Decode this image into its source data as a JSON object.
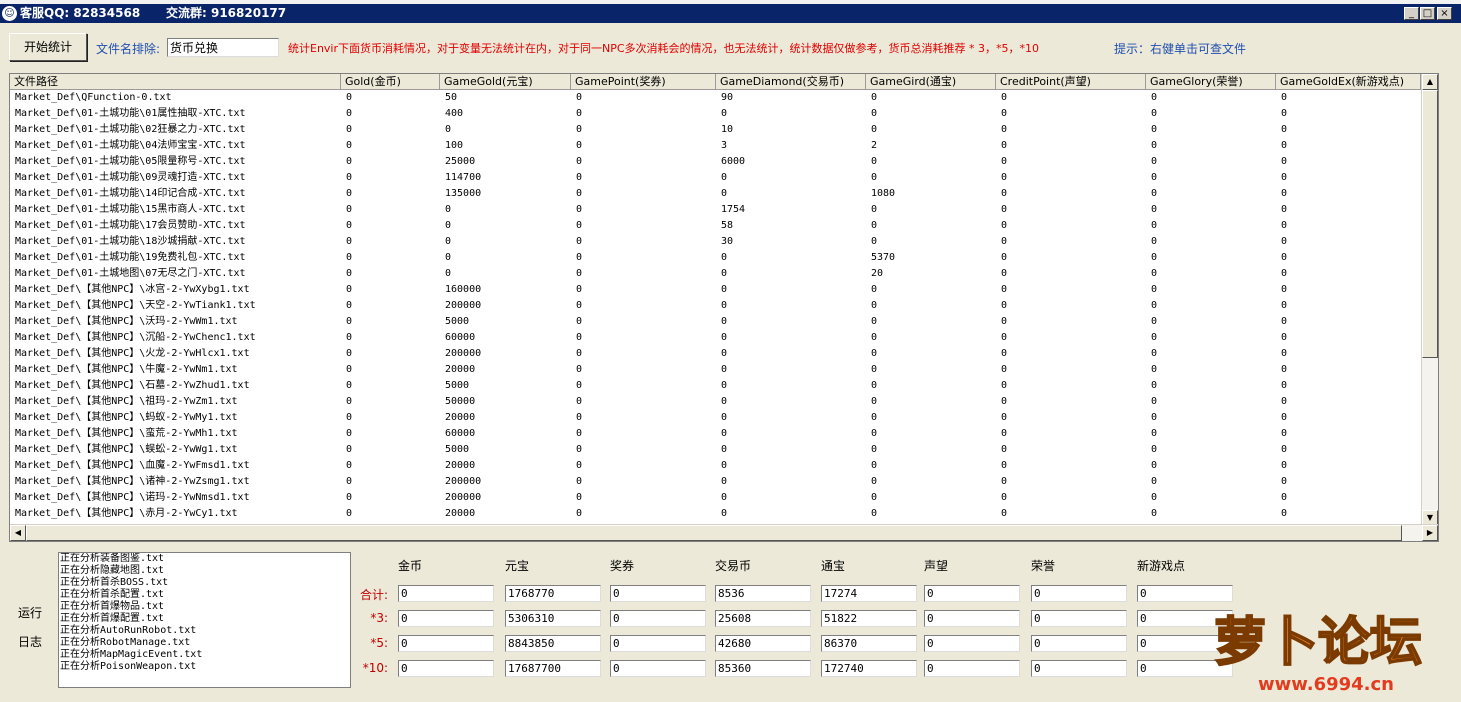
{
  "titlebar": {
    "title": "客服QQ: 82834568",
    "group": "交流群: 916820177"
  },
  "toolbar": {
    "start_button": "开始统计",
    "exclude_label": "文件名排除:",
    "exclude_value": "货币兑换",
    "note": "统计Envir下面货币消耗情况，对于变量无法统计在内，对于同一NPC多次消耗会的情况，也无法统计，统计数据仅做参考，货币总消耗推荐 * 3，*5，*10",
    "hint": "提示：右健单击可查文件"
  },
  "table": {
    "columns": [
      "文件路径",
      "Gold(金币)",
      "GameGold(元宝)",
      "GamePoint(奖券)",
      "GameDiamond(交易币)",
      "GameGird(通宝)",
      "CreditPoint(声望)",
      "GameGlory(荣誉)",
      "GameGoldEx(新游戏点)"
    ],
    "rows": [
      [
        "Market_Def\\QFunction-0.txt",
        "0",
        "50",
        "0",
        "90",
        "0",
        "0",
        "0",
        "0"
      ],
      [
        "Market_Def\\01-土城功能\\01属性抽取-XTC.txt",
        "0",
        "400",
        "0",
        "0",
        "0",
        "0",
        "0",
        "0"
      ],
      [
        "Market_Def\\01-土城功能\\02狂暴之力-XTC.txt",
        "0",
        "0",
        "0",
        "10",
        "0",
        "0",
        "0",
        "0"
      ],
      [
        "Market_Def\\01-土城功能\\04法师宝宝-XTC.txt",
        "0",
        "100",
        "0",
        "3",
        "2",
        "0",
        "0",
        "0"
      ],
      [
        "Market_Def\\01-土城功能\\05限量称号-XTC.txt",
        "0",
        "25000",
        "0",
        "6000",
        "0",
        "0",
        "0",
        "0"
      ],
      [
        "Market_Def\\01-土城功能\\09灵魂打造-XTC.txt",
        "0",
        "114700",
        "0",
        "0",
        "0",
        "0",
        "0",
        "0"
      ],
      [
        "Market_Def\\01-土城功能\\14印记合成-XTC.txt",
        "0",
        "135000",
        "0",
        "0",
        "1080",
        "0",
        "0",
        "0"
      ],
      [
        "Market_Def\\01-土城功能\\15黑市商人-XTC.txt",
        "0",
        "0",
        "0",
        "1754",
        "0",
        "0",
        "0",
        "0"
      ],
      [
        "Market_Def\\01-土城功能\\17会员赞助-XTC.txt",
        "0",
        "0",
        "0",
        "58",
        "0",
        "0",
        "0",
        "0"
      ],
      [
        "Market_Def\\01-土城功能\\18沙城捐献-XTC.txt",
        "0",
        "0",
        "0",
        "30",
        "0",
        "0",
        "0",
        "0"
      ],
      [
        "Market_Def\\01-土城功能\\19免费礼包-XTC.txt",
        "0",
        "0",
        "0",
        "0",
        "5370",
        "0",
        "0",
        "0"
      ],
      [
        "Market_Def\\01-土城地图\\07无尽之门-XTC.txt",
        "0",
        "0",
        "0",
        "0",
        "20",
        "0",
        "0",
        "0"
      ],
      [
        "Market_Def\\【其他NPC】\\冰宫-2-YwXybg1.txt",
        "0",
        "160000",
        "0",
        "0",
        "0",
        "0",
        "0",
        "0"
      ],
      [
        "Market_Def\\【其他NPC】\\天空-2-YwTiank1.txt",
        "0",
        "200000",
        "0",
        "0",
        "0",
        "0",
        "0",
        "0"
      ],
      [
        "Market_Def\\【其他NPC】\\沃玛-2-YwWm1.txt",
        "0",
        "5000",
        "0",
        "0",
        "0",
        "0",
        "0",
        "0"
      ],
      [
        "Market_Def\\【其他NPC】\\沉船-2-YwChenc1.txt",
        "0",
        "60000",
        "0",
        "0",
        "0",
        "0",
        "0",
        "0"
      ],
      [
        "Market_Def\\【其他NPC】\\火龙-2-YwHlcx1.txt",
        "0",
        "200000",
        "0",
        "0",
        "0",
        "0",
        "0",
        "0"
      ],
      [
        "Market_Def\\【其他NPC】\\牛魔-2-YwNm1.txt",
        "0",
        "20000",
        "0",
        "0",
        "0",
        "0",
        "0",
        "0"
      ],
      [
        "Market_Def\\【其他NPC】\\石墓-2-YwZhud1.txt",
        "0",
        "5000",
        "0",
        "0",
        "0",
        "0",
        "0",
        "0"
      ],
      [
        "Market_Def\\【其他NPC】\\祖玛-2-YwZm1.txt",
        "0",
        "50000",
        "0",
        "0",
        "0",
        "0",
        "0",
        "0"
      ],
      [
        "Market_Def\\【其他NPC】\\蚂蚁-2-YwMy1.txt",
        "0",
        "20000",
        "0",
        "0",
        "0",
        "0",
        "0",
        "0"
      ],
      [
        "Market_Def\\【其他NPC】\\蛮荒-2-YwMh1.txt",
        "0",
        "60000",
        "0",
        "0",
        "0",
        "0",
        "0",
        "0"
      ],
      [
        "Market_Def\\【其他NPC】\\蜈蚣-2-YwWg1.txt",
        "0",
        "5000",
        "0",
        "0",
        "0",
        "0",
        "0",
        "0"
      ],
      [
        "Market_Def\\【其他NPC】\\血魔-2-YwFmsd1.txt",
        "0",
        "20000",
        "0",
        "0",
        "0",
        "0",
        "0",
        "0"
      ],
      [
        "Market_Def\\【其他NPC】\\诸神-2-YwZsmg1.txt",
        "0",
        "200000",
        "0",
        "0",
        "0",
        "0",
        "0",
        "0"
      ],
      [
        "Market_Def\\【其他NPC】\\诺玛-2-YwNmsd1.txt",
        "0",
        "200000",
        "0",
        "0",
        "0",
        "0",
        "0",
        "0"
      ],
      [
        "Market_Def\\【其他NPC】\\赤月-2-YwCy1.txt",
        "0",
        "20000",
        "0",
        "0",
        "0",
        "0",
        "0",
        "0"
      ]
    ]
  },
  "log": {
    "label_line1": "运行",
    "label_line2": "日志",
    "lines": [
      "正在分析装备图鉴.txt",
      "正在分析隐藏地图.txt",
      "正在分析首杀BOSS.txt",
      "正在分析首杀配置.txt",
      "正在分析首爆物品.txt",
      "正在分析首爆配置.txt",
      "正在分析AutoRunRobot.txt",
      "正在分析RobotManage.txt",
      "正在分析MapMagicEvent.txt",
      "正在分析PoisonWeapon.txt"
    ]
  },
  "stats": {
    "headers": [
      "金币",
      "元宝",
      "奖券",
      "交易币",
      "通宝",
      "声望",
      "荣誉",
      "新游戏点"
    ],
    "rows": [
      {
        "label": "合计:",
        "values": [
          "0",
          "1768770",
          "0",
          "8536",
          "17274",
          "0",
          "0",
          "0"
        ]
      },
      {
        "label": "*3:",
        "values": [
          "0",
          "5306310",
          "0",
          "25608",
          "51822",
          "0",
          "0",
          "0"
        ]
      },
      {
        "label": "*5:",
        "values": [
          "0",
          "8843850",
          "0",
          "42680",
          "86370",
          "0",
          "0",
          "0"
        ]
      },
      {
        "label": "*10:",
        "values": [
          "0",
          "17687700",
          "0",
          "85360",
          "172740",
          "0",
          "0",
          "0"
        ]
      }
    ]
  },
  "watermark": {
    "brand": "萝卜论坛",
    "url": "www.6994.cn"
  },
  "colors": {
    "titlebar": "#0a246a",
    "note_red": "#e00000",
    "hint_blue": "#1f4fb0",
    "row_label_red": "#c00000"
  }
}
